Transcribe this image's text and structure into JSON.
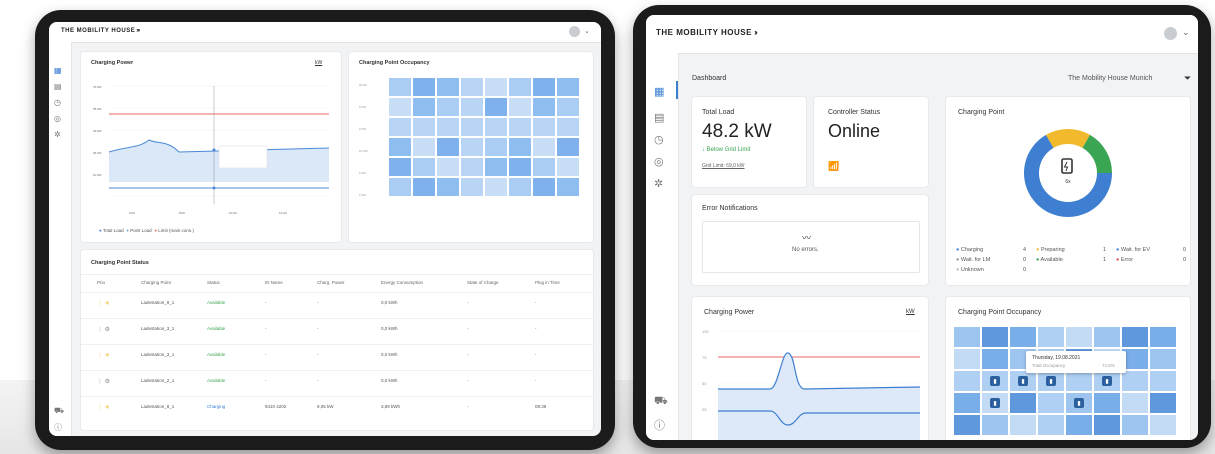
{
  "left": {
    "logo": "THE MOBILITY HOUSE",
    "logo_mark": "›››",
    "charging_power": {
      "title": "Charging Power",
      "unit": "kW",
      "legend": [
        "Total Load",
        "Point Load",
        "Limit (main conn.)"
      ]
    },
    "occupancy": {
      "title": "Charging Point Occupancy"
    },
    "status_table": {
      "title": "Charging Point Status",
      "headers": [
        "Prio",
        "Charging Point",
        "Status",
        "ID Name",
        "Charg. Power",
        "Energy Consumption",
        "State of Charge",
        "Plug in Time"
      ],
      "rows": [
        {
          "point": "Ladestation_9_1",
          "status": "Available",
          "id": "-",
          "power": "-",
          "energy": "0,0 kWh",
          "soc": "-",
          "plug": "-"
        },
        {
          "point": "Ladestation_3_1",
          "status": "Available",
          "id": "-",
          "power": "-",
          "energy": "0,0 kWh",
          "soc": "-",
          "plug": "-"
        },
        {
          "point": "Ladestation_3_1",
          "status": "Available",
          "id": "-",
          "power": "-",
          "energy": "0,0 kWh",
          "soc": "-",
          "plug": "-"
        },
        {
          "point": "Ladestation_2_1",
          "status": "Available",
          "id": "-",
          "power": "-",
          "energy": "0,0 kWh",
          "soc": "-",
          "plug": "-"
        },
        {
          "point": "Ladestation_8_1",
          "status": "Charging",
          "id": "9410 4202",
          "power": "9,05 kW",
          "energy": "3,89 kWh",
          "soc": "-",
          "plug": "08:36"
        }
      ]
    }
  },
  "right": {
    "logo": "THE MOBILITY HOUSE",
    "logo_mark": "›››",
    "header": {
      "title": "Dashboard",
      "location": "The Mobility House Munich"
    },
    "total_load": {
      "label": "Total Load",
      "value": "48.2 kW",
      "below": "Below Grid Limit",
      "grid": "Grid Limit: 69,0 kW"
    },
    "controller": {
      "label": "Controller Status",
      "value": "Online"
    },
    "error": {
      "title": "Error Notifications",
      "empty": "No errors."
    },
    "charging_point": {
      "title": "Charging Point",
      "center": "6x",
      "colors": {
        "charging": "#3f7fd1",
        "preparing": "#f2b92c",
        "available": "#3aa552"
      },
      "legend": [
        {
          "label": "Charging",
          "count": "4"
        },
        {
          "label": "Preparing",
          "count": "1"
        },
        {
          "label": "Wait. for EV",
          "count": "0"
        },
        {
          "label": "Wait. for LM",
          "count": "0"
        },
        {
          "label": "Available",
          "count": "1"
        },
        {
          "label": "Error",
          "count": "0"
        },
        {
          "label": "Unknown",
          "count": "0"
        }
      ]
    },
    "charging_power": {
      "title": "Charging Power",
      "unit": "kW",
      "y_ticks": [
        "100",
        "75",
        "50",
        "25"
      ]
    },
    "occupancy": {
      "title": "Charging Point Occupancy",
      "tooltip_date": "Thursday, 19.08.2021",
      "tooltip_label": "Total Occupancy",
      "tooltip_value": "74.5%"
    }
  }
}
